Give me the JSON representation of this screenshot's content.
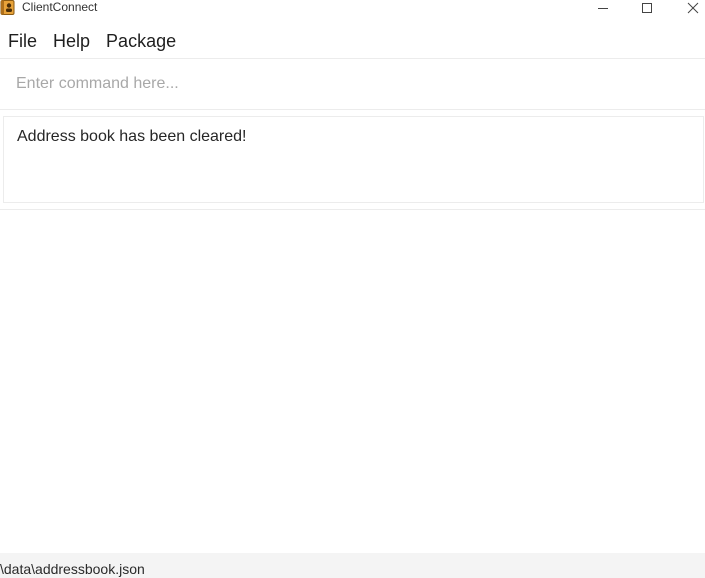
{
  "window": {
    "title": "ClientConnect",
    "icon": "address-book-icon",
    "controls": [
      "minimize-icon",
      "maximize-icon",
      "close-icon"
    ]
  },
  "menu": {
    "file": "File",
    "help": "Help",
    "package": "Package"
  },
  "command": {
    "placeholder": "Enter command here...",
    "value": ""
  },
  "result": {
    "message": "Address book has been cleared!"
  },
  "status": {
    "path": "\\data\\addressbook.json"
  },
  "colors": {
    "icon_orange": "#e8a33a",
    "separator": "#ececec",
    "statusbar_bg": "#f4f4f4",
    "placeholder": "#a8a8a8"
  }
}
